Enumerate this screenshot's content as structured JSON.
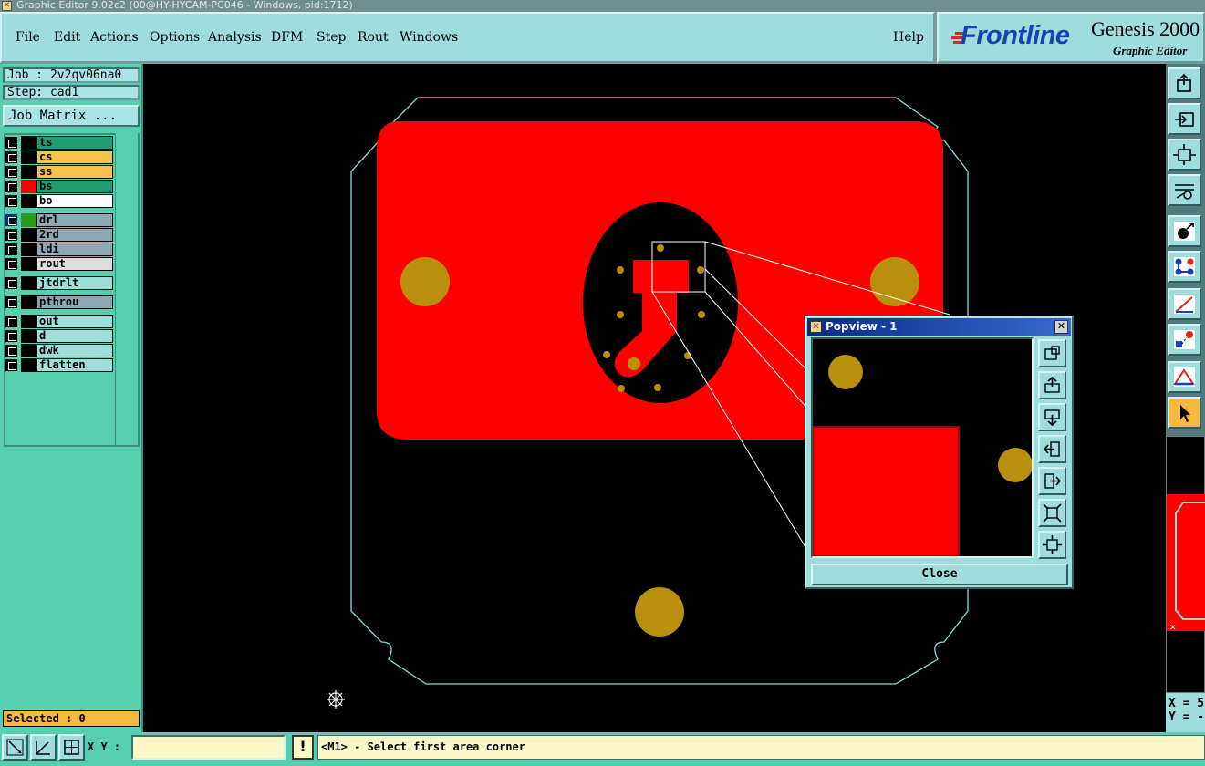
{
  "window": {
    "title": "Graphic Editor 9.02c2 (00@HY-HYCAM-PC046 - Windows, pid:1712)"
  },
  "menu": {
    "items": [
      "File",
      "Edit",
      "Actions",
      "Options",
      "Analysis",
      "DFM",
      "Step",
      "Rout",
      "Windows"
    ],
    "help": "Help"
  },
  "logo": {
    "brand": "Frontline",
    "product": "Genesis 2000",
    "subtitle": "Graphic Editor"
  },
  "job": {
    "job_text": "Job : 2v2qv06na0",
    "step_text": "Step: cad1",
    "matrix_button": "Job Matrix ..."
  },
  "layers": [
    {
      "name": "ts",
      "color": "#1f9d73",
      "swatch": "#000000"
    },
    {
      "name": "cs",
      "color": "#f6c34f",
      "swatch": "#000000"
    },
    {
      "name": "ss",
      "color": "#f6c34f",
      "swatch": "#000000"
    },
    {
      "name": "bs",
      "color": "#1f9d73",
      "swatch": "#ff0000"
    },
    {
      "name": "bo",
      "color": "#ffffff",
      "swatch": "#000000"
    },
    {
      "name": "drl",
      "color": "#8fa7b3",
      "swatch": "#2f9a1c"
    },
    {
      "name": "2rd",
      "color": "#8fa7b3",
      "swatch": "#000000"
    },
    {
      "name": "ldi",
      "color": "#8fa7b3",
      "swatch": "#000000"
    },
    {
      "name": "rout",
      "color": "#dedede",
      "swatch": "#000000"
    },
    {
      "name": "jtdrlt",
      "color": "#9fdddd",
      "swatch": "#000000"
    },
    {
      "name": "pthrou",
      "color": "#8fa7b3",
      "swatch": "#000000"
    },
    {
      "name": "out",
      "color": "#9fdddd",
      "swatch": "#000000"
    },
    {
      "name": "d",
      "color": "#9fdddd",
      "swatch": "#000000"
    },
    {
      "name": "dwk",
      "color": "#9fdddd",
      "swatch": "#000000"
    },
    {
      "name": "flatten",
      "color": "#9fdddd",
      "swatch": "#000000"
    }
  ],
  "selected_text": "Selected : 0",
  "popview": {
    "title": "Popview - 1",
    "close_label": "Close"
  },
  "bottom": {
    "xy_label": "X Y :",
    "xy_value": "",
    "alert_glyph": "!",
    "status_text": "<M1> - Select first area corner"
  },
  "coords": {
    "x_text": "X = 5",
    "y_text": "Y = -"
  },
  "colors": {
    "board_fill": "#ff0000",
    "pad": "#b8900e",
    "outline": "#8fd7d7",
    "panel_bg": "#55cfae",
    "menu_bg": "#9fdddd"
  },
  "icons": {
    "right_toolbar": [
      "zoom-home-icon",
      "zoom-back-icon",
      "fit-screen-icon",
      "settings-tools-icon",
      "pad-snap-icon",
      "connect-points-icon",
      "measure-icon",
      "snap-features-icon",
      "triangle-tool-icon",
      "pointer-select-icon"
    ],
    "popview_toolbar": [
      "zoom-fit-icon",
      "pan-up-icon",
      "pan-down-icon",
      "pan-left-icon",
      "pan-right-icon",
      "zoom-in-icon",
      "zoom-out-icon"
    ],
    "bottom_toolbar": [
      "zoom-area-icon",
      "measure-angle-icon",
      "grid-snap-icon"
    ]
  }
}
